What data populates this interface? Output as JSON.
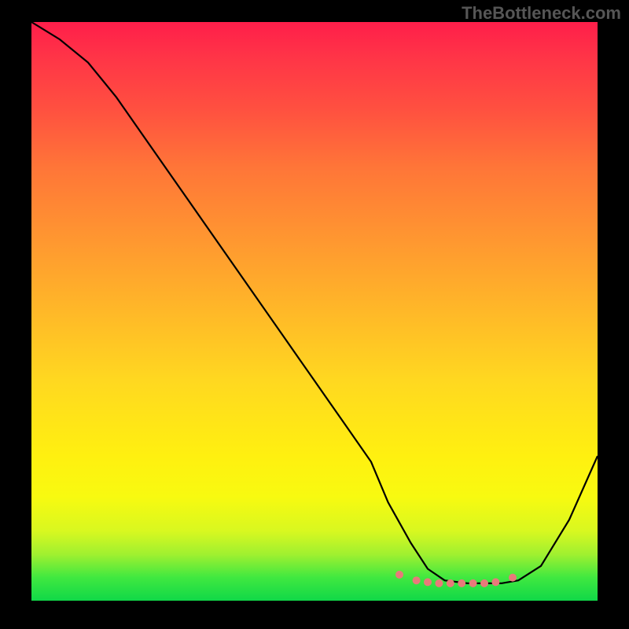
{
  "watermark": "TheBottleneck.com",
  "chart_data": {
    "type": "line",
    "title": "",
    "xlabel": "",
    "ylabel": "",
    "xlim": [
      0,
      100
    ],
    "ylim": [
      0,
      100
    ],
    "series": [
      {
        "name": "curve",
        "x": [
          0,
          5,
          10,
          15,
          20,
          25,
          30,
          35,
          40,
          45,
          50,
          55,
          60,
          63,
          67,
          70,
          73,
          77,
          80,
          83,
          86,
          90,
          95,
          100
        ],
        "y": [
          100,
          97,
          93,
          87,
          80,
          73,
          66,
          59,
          52,
          45,
          38,
          31,
          24,
          17,
          10,
          5.5,
          3.5,
          3,
          3,
          3,
          3.5,
          6,
          14,
          25
        ]
      },
      {
        "name": "bottom-dots",
        "x": [
          65,
          68,
          70,
          72,
          74,
          76,
          78,
          80,
          82,
          85
        ],
        "y": [
          4.5,
          3.5,
          3.2,
          3,
          3,
          3,
          3,
          3,
          3.2,
          4
        ]
      }
    ],
    "gradient_stops": [
      {
        "pos": 0,
        "color": "#ff1e4a"
      },
      {
        "pos": 100,
        "color": "#10d848"
      }
    ],
    "dot_color": "#e87a7a",
    "curve_color": "#000000"
  }
}
